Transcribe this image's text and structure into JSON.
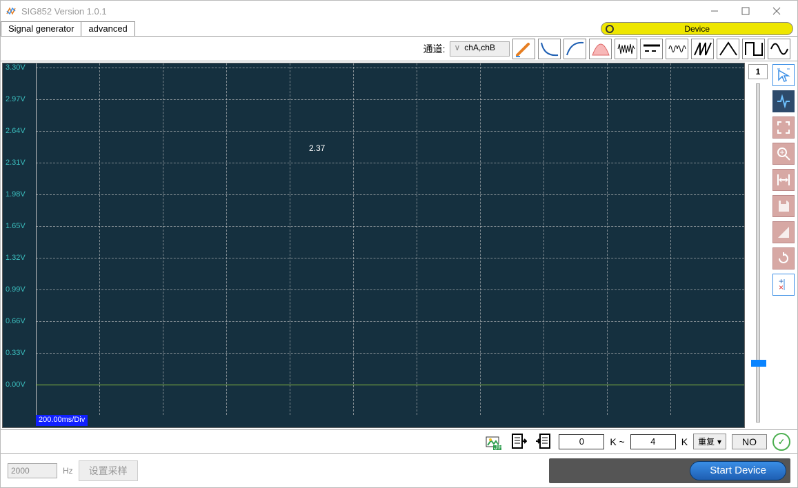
{
  "window": {
    "title": "SIG852  Version 1.0.1"
  },
  "tabs": {
    "signal": "Signal generator",
    "advanced": "advanced"
  },
  "device_btn": "Device",
  "toolbar": {
    "channel_label": "通道:",
    "channel_value": "chA,chB"
  },
  "yaxis": [
    "3.30V",
    "2.97V",
    "2.64V",
    "2.31V",
    "1.98V",
    "1.65V",
    "1.32V",
    "0.99V",
    "0.66V",
    "0.33V",
    "0.00V"
  ],
  "cursor_value": "2.37",
  "xdiv": "200.00ms/Div",
  "slider": {
    "top_label": "1"
  },
  "bottom1": {
    "k_from": "0",
    "k_to": "4",
    "k_sep": "K ~",
    "k_suffix": "K",
    "repeat": "重复",
    "no": "NO"
  },
  "bottom2": {
    "hz_value": "2000",
    "hz_label": "Hz",
    "sample_btn": "设置采样",
    "start_btn": "Start Device"
  }
}
